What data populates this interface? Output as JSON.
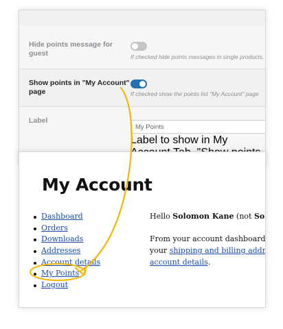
{
  "settings": {
    "hide_points": {
      "label": "Hide points message for guest",
      "help": "If checked hide points messages in single products, c",
      "enabled": false
    },
    "show_points": {
      "label": "Show points in \"My Account\" page",
      "help": "If checked show the points list \"My Account\" page",
      "enabled": true
    },
    "label_field": {
      "label": "Label",
      "value": "My Points",
      "help": "Label to show in My Account Tab. \"Show points in My"
    }
  },
  "account": {
    "title": "My Account",
    "nav": [
      "Dashboard",
      "Orders",
      "Downloads",
      "Addresses",
      "Account details",
      "My Points",
      "Logout"
    ],
    "greeting_prefix": "Hello ",
    "greeting_name": "Solomon Kane",
    "greeting_mid": " (not ",
    "greeting_name2": "Solomon",
    "dashboard_line1": "From your account dashboard you c",
    "dashboard_line2_prefix": "your ",
    "dashboard_link1": "shipping and billing addresses",
    "dashboard_link2": "account details",
    "dashboard_line3_suffix": "."
  },
  "colors": {
    "accent": "#2271b1",
    "link": "#1a4aa8",
    "highlight": "#f2b705"
  }
}
